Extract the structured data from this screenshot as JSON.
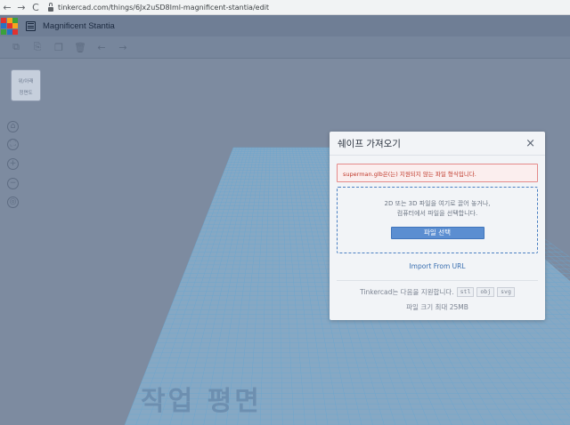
{
  "browser": {
    "url": "tinkercad.com/things/6Jx2uSD8Iml-magnificent-stantia/edit",
    "back_icon": "←",
    "forward_icon": "→",
    "reload_icon": "C"
  },
  "app": {
    "logo_letters": [
      "T",
      "I",
      "N",
      "K",
      "E",
      "R",
      "C",
      "A",
      "D"
    ],
    "logo_colors": [
      "#e1322f",
      "#f7a51c",
      "#3ba13a",
      "#2574c4",
      "#e1322f",
      "#f7a51c",
      "#3ba13a",
      "#2574c4",
      "#e1322f"
    ],
    "title": "Magnificent Stantia"
  },
  "toolbar": {
    "icons": [
      "copy-icon",
      "paste-icon",
      "duplicate-icon",
      "delete-icon",
      "undo-icon",
      "redo-icon"
    ],
    "glyphs": [
      "⧉",
      "⎘",
      "❐",
      "🗑",
      "←",
      "→"
    ]
  },
  "viewcube": {
    "top_label": "위/아래",
    "front_label": "정면도"
  },
  "side_tools": {
    "glyphs": [
      "⌂",
      "⛶",
      "+",
      "−",
      "◎"
    ],
    "names": [
      "home-view-icon",
      "fit-view-icon",
      "zoom-in-icon",
      "zoom-out-icon",
      "orthographic-icon"
    ]
  },
  "workplane": {
    "label": "작업 평면"
  },
  "modal": {
    "title": "쉐이프 가져오기",
    "close": "×",
    "error": "superman.glb은(는) 지원되지 않는 파일 형식입니다.",
    "drop_line1": "2D 또는 3D 파일을 여기로 끌어 놓거나,",
    "drop_line2": "컴퓨터에서 파일을 선택합니다.",
    "choose_button": "파일 선택",
    "import_url": "Import From URL",
    "support_text": "Tinkercad는 다음을 지원합니다.",
    "formats": [
      "stl",
      "obj",
      "svg"
    ],
    "max_size": "파일 크기 최대 25MB"
  },
  "colors": {
    "grid_line": "#6aa6cf",
    "error": "#c0392b",
    "primary_button": "#5b8ed1"
  }
}
